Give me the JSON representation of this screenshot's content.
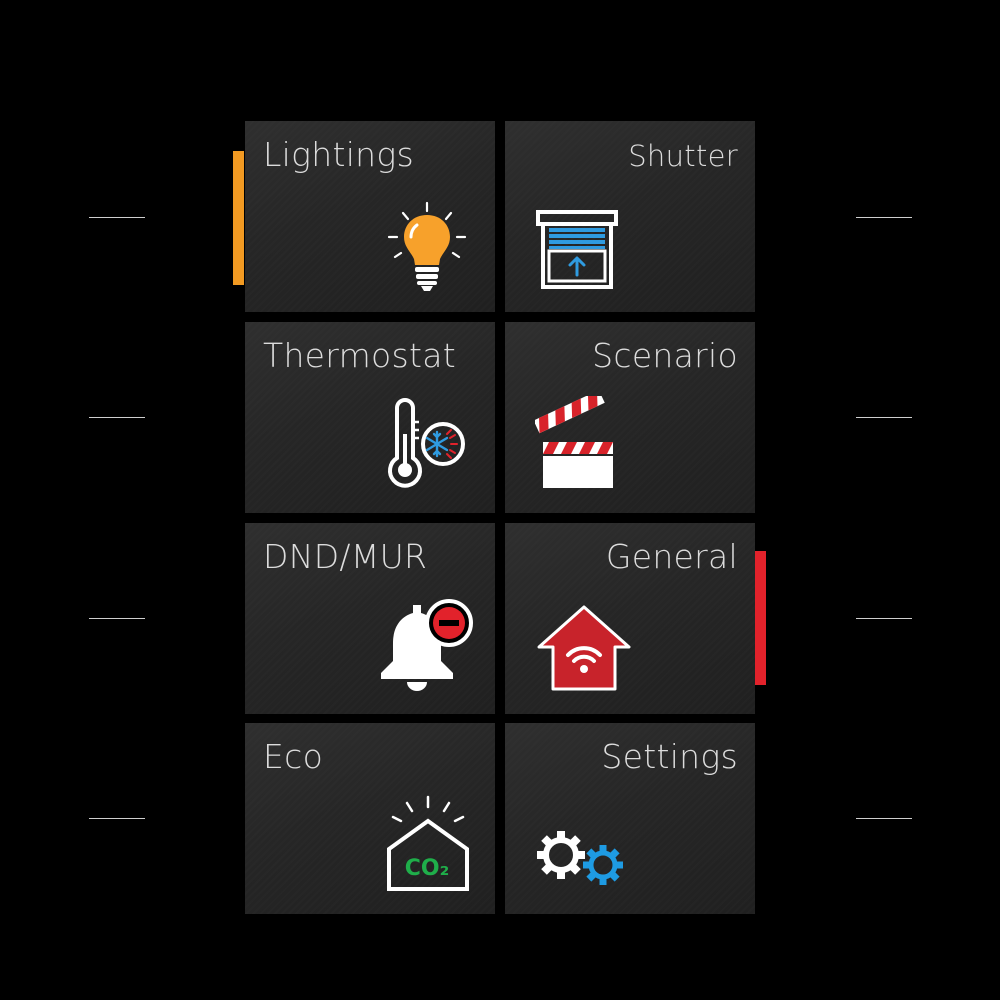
{
  "tiles": [
    {
      "id": "lightings",
      "label": "Lightings",
      "icon": "light-bulb-icon"
    },
    {
      "id": "shutter",
      "label": "Shutter",
      "icon": "shutter-icon"
    },
    {
      "id": "thermostat",
      "label": "Thermostat",
      "icon": "thermostat-icon"
    },
    {
      "id": "scenario",
      "label": "Scenario",
      "icon": "clapperboard-icon"
    },
    {
      "id": "dnd-mur",
      "label": "DND/MUR",
      "icon": "bell-dnd-icon"
    },
    {
      "id": "general",
      "label": "General",
      "icon": "home-wifi-icon"
    },
    {
      "id": "eco",
      "label": "Eco",
      "icon": "house-co2-icon"
    },
    {
      "id": "settings",
      "label": "Settings",
      "icon": "gears-icon"
    }
  ],
  "icon_text": {
    "co2": "CO₂"
  },
  "colors": {
    "background": "#000000",
    "tile": "#2a2a2a",
    "label": "#dcdcdc",
    "accent_left": "#f29a22",
    "accent_right": "#e2222b",
    "bulb": "#f7a12b",
    "shutter_blue": "#2f9be0",
    "thermo_blue": "#2f9be0",
    "thermo_red": "#e2222b",
    "clapper_red": "#d8232a",
    "dnd_red": "#e2222b",
    "house_red": "#c8232b",
    "co2_green": "#1fae4a",
    "gear_blue": "#1e9be3"
  }
}
